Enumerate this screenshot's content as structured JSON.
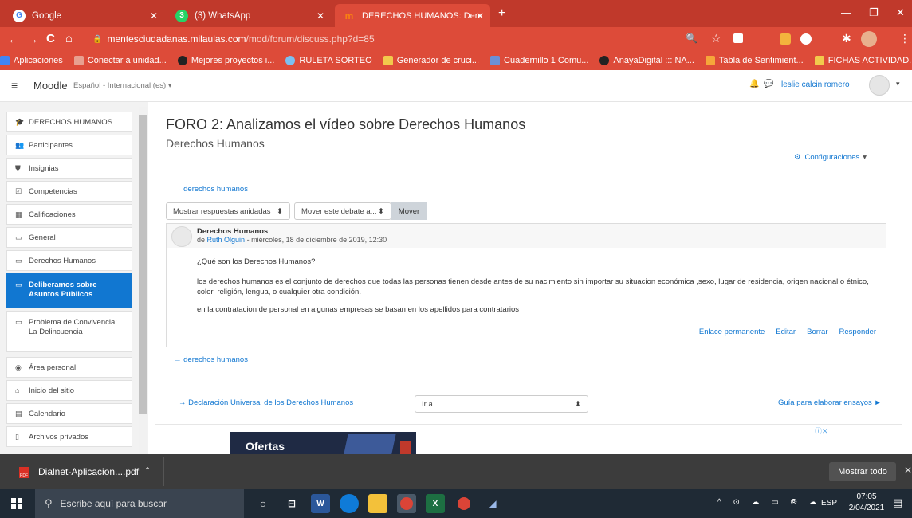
{
  "browser": {
    "tabs": [
      {
        "title": "Google",
        "icon": "google-icon"
      },
      {
        "title": "(3) WhatsApp",
        "icon": "whatsapp-icon"
      },
      {
        "title": "DERECHOS HUMANOS: Derecho",
        "icon": "moodle-icon"
      }
    ],
    "new_tab_label": "+",
    "url_domain": "mentesciudadanas.milaulas.com",
    "url_path": "/mod/forum/discuss.php?d=85",
    "bookmarks": [
      "Aplicaciones",
      "Conectar a unidad...",
      "Mejores proyectos i...",
      "RULETA SORTEO",
      "Generador de cruci...",
      "Cuadernillo 1 Comu...",
      "AnayaDigital ::: NA...",
      "Tabla de Sentimient...",
      "FICHAS ACTIVIDAD..."
    ],
    "bookmark_more": "»"
  },
  "moodle": {
    "brand": "Moodle",
    "language": "Español - Internacional (es) ▾",
    "user_name": "leslie calcin romero"
  },
  "sidebar": {
    "items": [
      {
        "label": "DERECHOS HUMANOS",
        "icon": "course-icon"
      },
      {
        "label": "Participantes",
        "icon": "users-icon"
      },
      {
        "label": "Insignias",
        "icon": "badge-icon"
      },
      {
        "label": "Competencias",
        "icon": "check-icon"
      },
      {
        "label": "Calificaciones",
        "icon": "table-icon"
      },
      {
        "label": "General",
        "icon": "folder-icon"
      },
      {
        "label": "Derechos Humanos",
        "icon": "folder-icon"
      },
      {
        "label": "Deliberamos sobre Asuntos Públicos",
        "icon": "folder-icon"
      },
      {
        "label": "Problema de Convivencia: La Delincuencia",
        "icon": "folder-icon"
      },
      {
        "label": "Área personal",
        "icon": "dashboard-icon"
      },
      {
        "label": "Inicio del sitio",
        "icon": "home-icon"
      },
      {
        "label": "Calendario",
        "icon": "calendar-icon"
      },
      {
        "label": "Archivos privados",
        "icon": "file-icon"
      }
    ]
  },
  "forum": {
    "title": "FORO 2: Analizamos el vídeo sobre Derechos Humanos",
    "subtitle": "Derechos Humanos",
    "settings_label": "Configuraciones",
    "prev_link": "derechos humanos",
    "display_mode": "Mostrar respuestas anidadas",
    "move_select": "Mover este debate a...",
    "move_button": "Mover",
    "post": {
      "subject": "Derechos Humanos",
      "by_prefix": "de",
      "author": "Ruth Olguin",
      "date": "- miércoles, 18 de diciembre de 2019, 12:30",
      "p1": "¿Qué son los Derechos Humanos?",
      "p2": "los derechos humanos  es el conjunto de derechos que todas las personas tienen desde antes de su nacimiento sin importar su situacion económica ,sexo, lugar de residencia, origen nacional o étnico, color, religión, lengua, o cualquier otra condición.",
      "p3": "en la contratacion de personal en algunas empresas se basan en los apellidos para contratarios",
      "actions": [
        "Enlace permanente",
        "Editar",
        "Borrar",
        "Responder"
      ]
    },
    "bottom_link": "derechos humanos",
    "prev_activity": "Declaración Universal de los Derechos Humanos",
    "jump_placeholder": "Ir a...",
    "next_activity": "Guía para elaborar ensayos ►",
    "ad_text": "Ofertas"
  },
  "downloads": {
    "file": "Dialnet-Aplicacion....pdf",
    "show_all": "Mostrar todo"
  },
  "taskbar": {
    "search_placeholder": "Escribe aquí para buscar",
    "lang": "ESP",
    "time": "07:05",
    "date": "2/04/2021"
  }
}
